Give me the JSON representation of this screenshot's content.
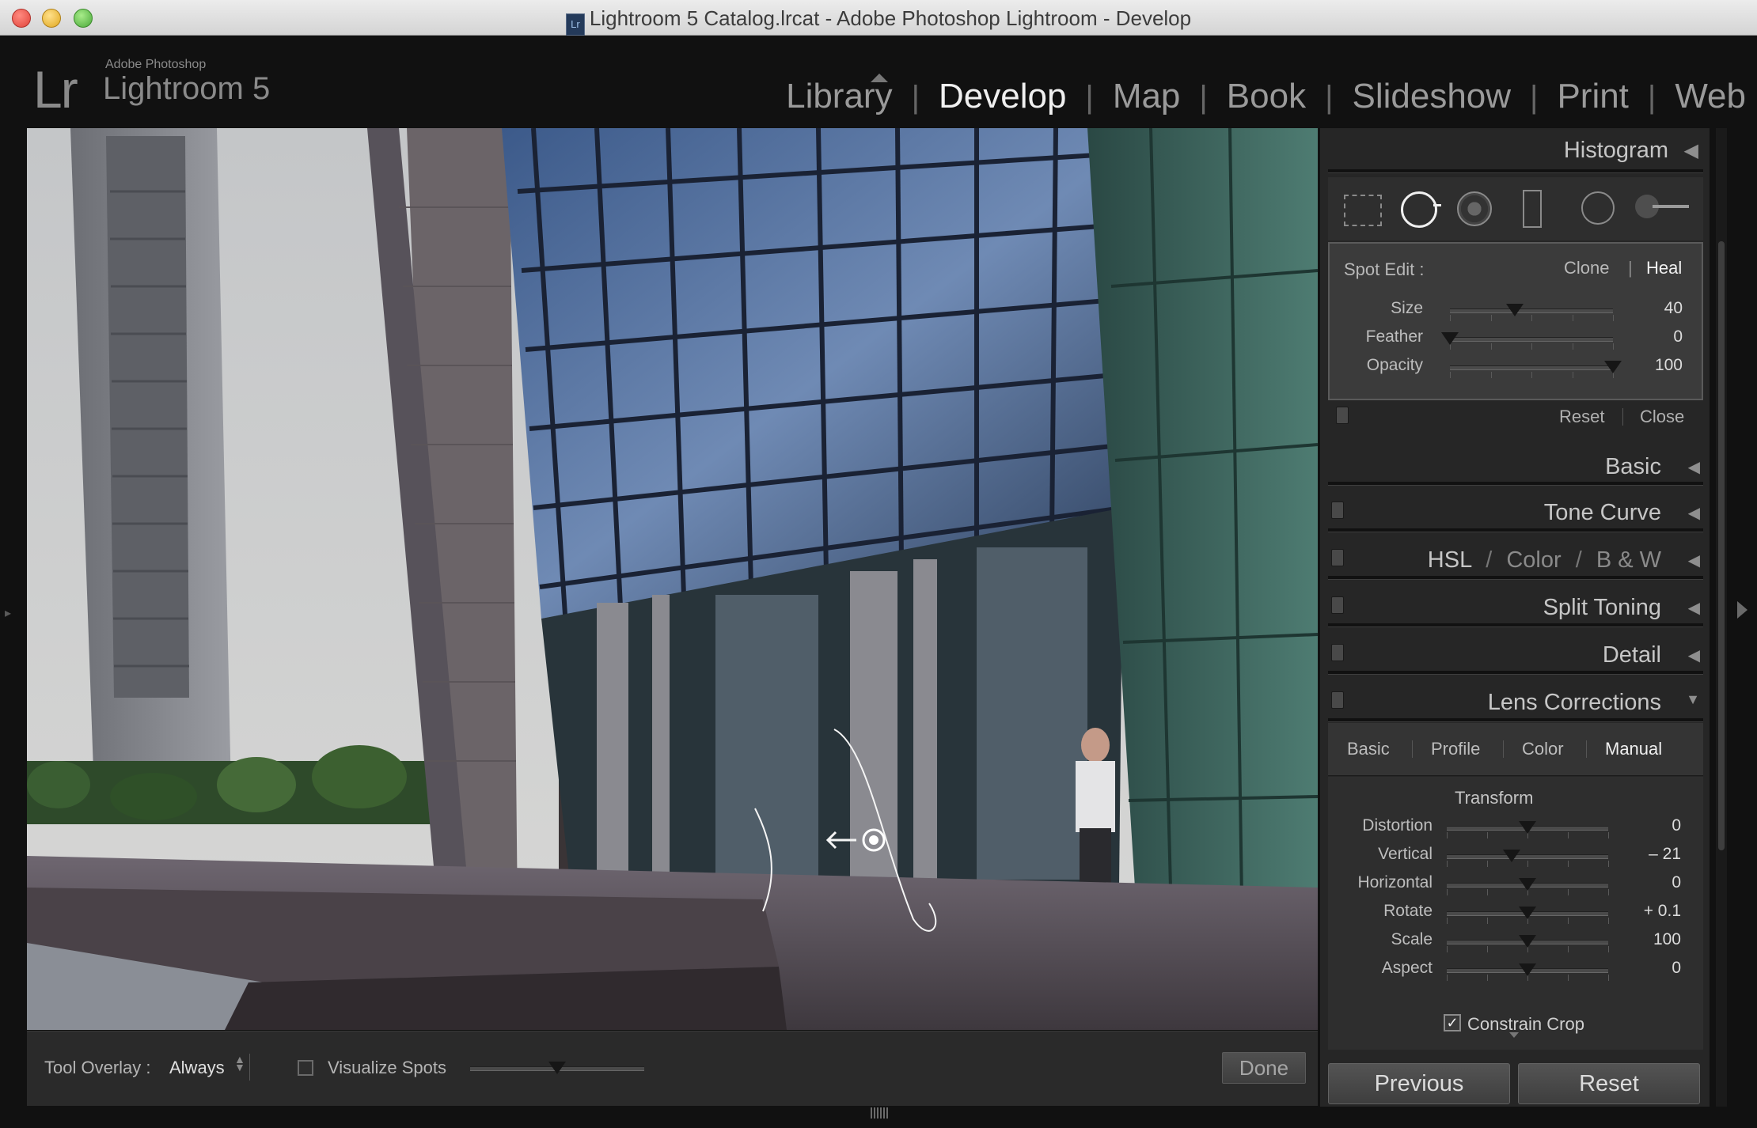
{
  "window": {
    "title": "Lightroom 5 Catalog.lrcat - Adobe Photoshop Lightroom - Develop",
    "icon_text": "Lr"
  },
  "identity": {
    "mark": "Lr",
    "small": "Adobe Photoshop",
    "big": "Lightroom 5"
  },
  "modules": [
    "Library",
    "Develop",
    "Map",
    "Book",
    "Slideshow",
    "Print",
    "Web"
  ],
  "active_module": "Develop",
  "panel": {
    "histogram_label": "Histogram",
    "tool_icons": [
      "crop-overlay-icon",
      "spot-removal-icon",
      "red-eye-icon",
      "graduated-filter-icon",
      "radial-filter-icon",
      "adjustment-brush-icon"
    ],
    "spot_edit": {
      "label": "Spot Edit :",
      "clone": "Clone",
      "sep": "|",
      "heal": "Heal",
      "sliders": [
        {
          "label": "Size",
          "value": "40",
          "pos": 0.4
        },
        {
          "label": "Feather",
          "value": "0",
          "pos": 0.0
        },
        {
          "label": "Opacity",
          "value": "100",
          "pos": 1.0
        }
      ],
      "reset": "Reset",
      "close": "Close"
    },
    "sections": [
      "Basic",
      "Tone Curve",
      "Split Toning",
      "Detail",
      "Lens Corrections"
    ],
    "hsl": {
      "hsl": "HSL",
      "slash": "/",
      "color": "Color",
      "bw": "B & W"
    },
    "lens": {
      "tabs": [
        "Basic",
        "Profile",
        "Color",
        "Manual"
      ],
      "active_tab": "Manual",
      "transform_label": "Transform",
      "sliders": [
        {
          "label": "Distortion",
          "value": "0",
          "pos": 0.5
        },
        {
          "label": "Vertical",
          "value": "– 21",
          "pos": 0.4
        },
        {
          "label": "Horizontal",
          "value": "0",
          "pos": 0.5
        },
        {
          "label": "Rotate",
          "value": "+ 0.1",
          "pos": 0.5
        },
        {
          "label": "Scale",
          "value": "100",
          "pos": 0.5
        },
        {
          "label": "Aspect",
          "value": "0",
          "pos": 0.5
        }
      ],
      "constrain_crop": "Constrain Crop",
      "constrain_checked": true
    },
    "previous": "Previous",
    "reset": "Reset"
  },
  "toolbar": {
    "tool_overlay_label": "Tool Overlay :",
    "tool_overlay_value": "Always",
    "visualize_spots": "Visualize Spots",
    "visualize_slider_pos": 0.5,
    "done": "Done"
  },
  "colors": {
    "panel_bg": "#262626",
    "active_text": "#f0f0f0",
    "inactive_text": "#9a9a9a",
    "sky": "#a9adb0"
  }
}
